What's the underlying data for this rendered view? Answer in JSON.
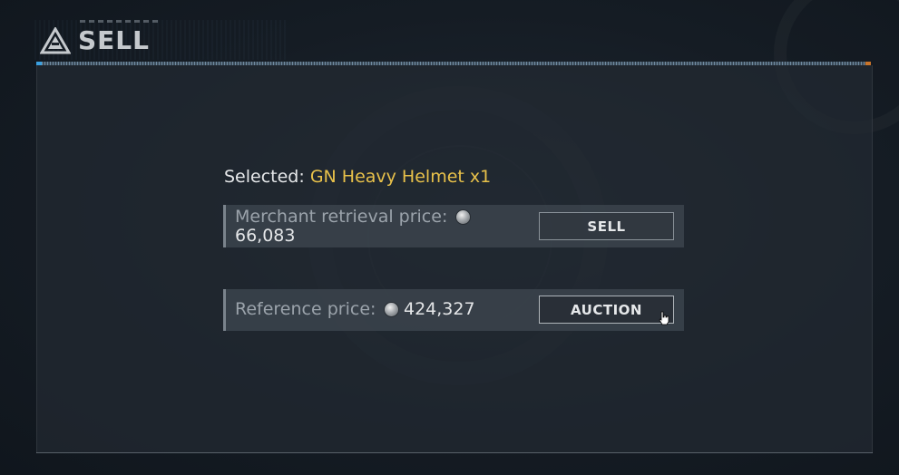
{
  "header": {
    "title": "SELL",
    "logo_icon": "triangle-emblem-icon"
  },
  "selected": {
    "prefix": "Selected: ",
    "item_name": "GN Heavy Helmet x1",
    "item_color": "#e8c14a"
  },
  "merchant_row": {
    "label": "Merchant retrieval price: ",
    "currency_icon": "silver-coin-icon",
    "price": "66,083",
    "button_label": "SELL"
  },
  "auction_row": {
    "label": "Reference price: ",
    "currency_icon": "silver-coin-icon",
    "price": "424,327",
    "button_label": "AUCTION"
  },
  "colors": {
    "accent_blue": "#3aa0e0",
    "accent_orange": "#c8742a",
    "panel_bg": "#222932"
  }
}
